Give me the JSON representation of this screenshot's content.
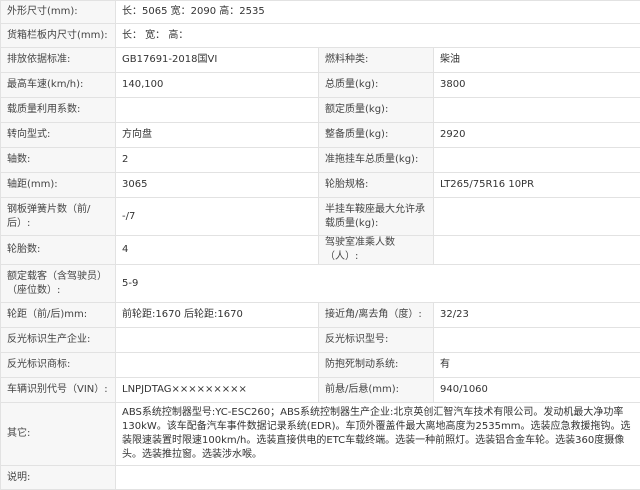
{
  "rows": [
    {
      "type": "wide",
      "label": "外形尺寸(mm):",
      "value": "长：5065 宽：2090 高：2535"
    },
    {
      "type": "wide",
      "label": "货箱栏板内尺寸(mm):",
      "value": "长：  宽：  高："
    },
    {
      "type": "pair",
      "l1": "排放依据标准:",
      "v1": "GB17691-2018国VI",
      "l2": "燃料种类:",
      "v2": "柴油"
    },
    {
      "type": "pair",
      "l1": "最高车速(km/h):",
      "v1": "140,100",
      "l2": "总质量(kg):",
      "v2": "3800"
    },
    {
      "type": "pair",
      "l1": "载质量利用系数:",
      "v1": "",
      "l2": "额定质量(kg):",
      "v2": ""
    },
    {
      "type": "pair",
      "l1": "转向型式:",
      "v1": "方向盘",
      "l2": "整备质量(kg):",
      "v2": "2920"
    },
    {
      "type": "pair",
      "l1": "轴数:",
      "v1": "2",
      "l2": "准拖挂车总质量(kg):",
      "v2": ""
    },
    {
      "type": "pair",
      "l1": "轴距(mm):",
      "v1": "3065",
      "l2": "轮胎规格:",
      "v2": "LT265/75R16 10PR"
    },
    {
      "type": "pair",
      "l1": "钢板弹簧片数（前/后）:",
      "v1": "-/7",
      "l2": "半挂车鞍座最大允许承载质量(kg):",
      "v2": ""
    },
    {
      "type": "pair",
      "l1": "轮胎数:",
      "v1": "4",
      "l2": "驾驶室准乘人数（人）:",
      "v2": ""
    },
    {
      "type": "wide",
      "label": "额定载客（含驾驶员）（座位数）:",
      "value": "5-9"
    },
    {
      "type": "pair",
      "l1": "轮距（前/后)mm:",
      "v1": "前轮距:1670 后轮距:1670",
      "l2": "接近角/离去角（度）:",
      "v2": "32/23"
    },
    {
      "type": "pair",
      "l1": "反光标识生产企业:",
      "v1": "",
      "l2": "反光标识型号:",
      "v2": ""
    },
    {
      "type": "pair",
      "l1": "反光标识商标:",
      "v1": "",
      "l2": "防抱死制动系统:",
      "v2": "有"
    },
    {
      "type": "pair",
      "l1": "车辆识别代号（VIN）:",
      "v1": "LNPJDTAG×××××××××",
      "l2": "前悬/后悬(mm):",
      "v2": "940/1060"
    },
    {
      "type": "wide",
      "label": "其它:",
      "value": "ABS系统控制器型号:YC-ESC260；ABS系统控制器生产企业:北京英创汇智汽车技术有限公司。发动机最大净功率130kW。该车配备汽车事件数据记录系统(EDR)。车顶外覆盖件最大离地高度为2535mm。选装应急救援拖钩。选装限速装置时限速100km/h。选装直接供电的ETC车载终端。选装一种前照灯。选装铝合金车轮。选装360度摄像头。选装推拉窗。选装涉水喉。"
    },
    {
      "type": "wide",
      "label": "说明:",
      "value": ""
    }
  ]
}
